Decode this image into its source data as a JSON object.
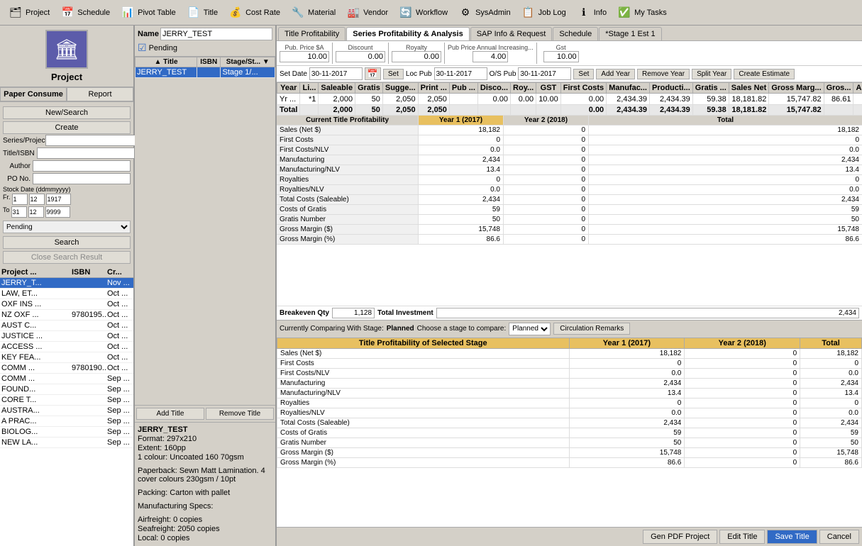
{
  "toolbar": {
    "items": [
      {
        "label": "Project",
        "icon": "🗂"
      },
      {
        "label": "Schedule",
        "icon": "📅"
      },
      {
        "label": "Pivot Table",
        "icon": "📊"
      },
      {
        "label": "Title",
        "icon": "📄"
      },
      {
        "label": "Cost Rate",
        "icon": "💰"
      },
      {
        "label": "Material",
        "icon": "🔧"
      },
      {
        "label": "Vendor",
        "icon": "🏭"
      },
      {
        "label": "Workflow",
        "icon": "🔄"
      },
      {
        "label": "SysAdmin",
        "icon": "⚙"
      },
      {
        "label": "Job Log",
        "icon": "📋"
      },
      {
        "label": "Info",
        "icon": "ℹ"
      },
      {
        "label": "My Tasks",
        "icon": "✅"
      }
    ]
  },
  "sidebar": {
    "project_label": "Project",
    "tabs": [
      {
        "label": "Paper Consume",
        "active": true
      },
      {
        "label": "Report"
      }
    ],
    "search_fields": [
      {
        "label": "Series/Project",
        "value": ""
      },
      {
        "label": "Title/ISBN",
        "value": ""
      },
      {
        "label": "Author",
        "value": ""
      },
      {
        "label": "PO No.",
        "value": ""
      }
    ],
    "stock_date_label": "Stock Date (ddmmyyyy)",
    "stock_from_dd": "1",
    "stock_from_mm": "12",
    "stock_from_yyyy": "1917",
    "stock_to_dd": "31",
    "stock_to_mm": "12",
    "stock_to_yyyy": "9999",
    "pending_options": [
      "Pending"
    ],
    "buttons": {
      "new_search": "New/Search",
      "create": "Create",
      "search": "Search",
      "close_search": "Close Search Result"
    }
  },
  "project_list": {
    "headers": [
      "Project ...",
      "ISBN",
      "Cr..."
    ],
    "rows": [
      {
        "col1": "JERRY_T...",
        "col2": "",
        "col3": "Nov ...",
        "selected": true
      },
      {
        "col1": "LAW, ET...",
        "col2": "",
        "col3": "Oct ..."
      },
      {
        "col1": "OXF INS ...",
        "col2": "",
        "col3": "Oct ..."
      },
      {
        "col1": "NZ OXF ...",
        "col2": "9780195...",
        "col3": "Oct ..."
      },
      {
        "col1": "AUST C...",
        "col2": "",
        "col3": "Oct ..."
      },
      {
        "col1": "JUSTICE ...",
        "col2": "",
        "col3": "Oct ..."
      },
      {
        "col1": "ACCESS ...",
        "col2": "",
        "col3": "Oct ..."
      },
      {
        "col1": "KEY FEA...",
        "col2": "",
        "col3": "Oct ..."
      },
      {
        "col1": "COMM ...",
        "col2": "9780190...",
        "col3": "Oct ..."
      },
      {
        "col1": "COMM ...",
        "col2": "",
        "col3": "Sep ..."
      },
      {
        "col1": "FOUND...",
        "col2": "",
        "col3": "Sep ..."
      },
      {
        "col1": "CORE T...",
        "col2": "",
        "col3": "Sep ..."
      },
      {
        "col1": "AUSTRA...",
        "col2": "",
        "col3": "Sep ..."
      },
      {
        "col1": "A PRAC...",
        "col2": "",
        "col3": "Sep ..."
      },
      {
        "col1": "BIOLOG...",
        "col2": "",
        "col3": "Sep ..."
      },
      {
        "col1": "NEW LA...",
        "col2": "",
        "col3": "Sep ..."
      }
    ]
  },
  "middle": {
    "name_label": "Name",
    "name_value": "JERRY_TEST",
    "pending_checked": true,
    "pending_label": "Pending",
    "titles_headers": [
      "Title",
      "ISBN",
      "Stage/St..."
    ],
    "titles": [
      {
        "title": "JERRY_TEST",
        "isbn": "",
        "stage": "Stage 1/...",
        "selected": true
      }
    ],
    "buttons": {
      "add": "Add Title",
      "remove": "Remove Title"
    },
    "title_info": {
      "name": "JERRY_TEST",
      "format": "Format: 297x210",
      "extent": "Extent: 160pp",
      "colour": "1 colour: Uncoated 160 70gsm",
      "binding": "Paperback: Sewn Matt Lamination. 4 cover colours 230gsm / 10pt",
      "packing": "Packing: Carton with pallet",
      "manuf_specs": "Manufacturing Specs:",
      "airfreight": "Airfreight: 0 copies",
      "seafreight": "Seafreight: 2050 copies",
      "local": "Local: 0 copies"
    }
  },
  "right": {
    "tabs": [
      {
        "label": "Title Profitability"
      },
      {
        "label": "Series Profitability & Analysis",
        "active": true
      },
      {
        "label": "SAP Info & Request"
      },
      {
        "label": "Schedule"
      },
      {
        "label": "*Stage 1 Est 1"
      }
    ],
    "pub_price_label": "Pub. Price $A",
    "pub_price_value": "10.00",
    "discount_label": "Discount",
    "discount_value": "0.00",
    "royalty_label": "Royalty",
    "royalty_value": "0.00",
    "pub_price_annual_label": "Pub Price Annual Increasing...",
    "pub_price_annual_value": "4.00",
    "gst_label": "Gst",
    "gst_value": "10.00",
    "date_row": {
      "set_date_label": "Set Date",
      "set_date_value": "30-11-2017",
      "set_btn": "Set",
      "loc_pub_label": "Loc Pub",
      "loc_pub_value": "30-11-2017",
      "os_pub_label": "O/S Pub",
      "os_pub_value": "30-11-2017",
      "set_btn2": "Set",
      "add_year_btn": "Add Year",
      "remove_year_btn": "Remove Year",
      "split_year_btn": "Split Year",
      "create_estimate_btn": "Create Estimate"
    },
    "data_table": {
      "headers": [
        "Year",
        "Li...",
        "Saleable",
        "Gratis",
        "Sugge...",
        "Print ...",
        "Pub ...",
        "Disco...",
        "Roy...",
        "GST",
        "First Costs",
        "Manufac...",
        "Producti...",
        "Gratis ...",
        "Sales Net",
        "Gross Marg...",
        "Gros...",
        "Au..."
      ],
      "rows": [
        {
          "yr": "Yr ...",
          "li": "*1",
          "saleable": "2,000",
          "gratis": "50",
          "sugge": "2,050",
          "print": "2,050",
          "pub": "",
          "disco": "0.00",
          "roy": "0.00",
          "gst": "10.00",
          "first_costs": "0.00",
          "manuf": "2,434.39",
          "prod": "2,434.39",
          "gratis_c": "59.38",
          "sales_net": "18,181.82",
          "gross_marg": "15,747.82",
          "gros_pct": "86.61",
          "au": "✓"
        },
        {
          "yr": "Total",
          "li": "",
          "saleable": "2,000",
          "gratis": "50",
          "sugge": "2,050",
          "print": "2,050",
          "pub": "",
          "disco": "",
          "roy": "",
          "gst": "",
          "first_costs": "0.00",
          "manuf": "2,434.39",
          "prod": "2,434.39",
          "gratis_c": "59.38",
          "sales_net": "18,181.82",
          "gross_marg": "15,747.82",
          "gros_pct": "",
          "au": "",
          "is_total": true
        }
      ]
    },
    "profitability": {
      "current_label": "Current Title Profitability",
      "year1_label": "Year 1 (2017)",
      "year2_label": "Year 2 (2018)",
      "total_label": "Total",
      "rows": [
        {
          "label": "Sales (Net $)",
          "y1": "18,182",
          "y2": "0",
          "total": "18,182"
        },
        {
          "label": "First Costs",
          "y1": "0",
          "y2": "0",
          "total": "0"
        },
        {
          "label": "First Costs/NLV",
          "y1": "0.0",
          "y2": "0",
          "total": "0.0"
        },
        {
          "label": "Manufacturing",
          "y1": "2,434",
          "y2": "0",
          "total": "2,434"
        },
        {
          "label": "Manufacturing/NLV",
          "y1": "13.4",
          "y2": "0",
          "total": "13.4"
        },
        {
          "label": "Royalties",
          "y1": "0",
          "y2": "0",
          "total": "0"
        },
        {
          "label": "Royalties/NLV",
          "y1": "0.0",
          "y2": "0",
          "total": "0.0"
        },
        {
          "label": "Total Costs (Saleable)",
          "y1": "2,434",
          "y2": "0",
          "total": "2,434"
        },
        {
          "label": "Costs of Gratis",
          "y1": "59",
          "y2": "0",
          "total": "59"
        },
        {
          "label": "Gratis Number",
          "y1": "50",
          "y2": "0",
          "total": "50"
        },
        {
          "label": "Gross Margin ($)",
          "y1": "15,748",
          "y2": "0",
          "total": "15,748"
        },
        {
          "label": "Gross Margin (%)",
          "y1": "86.6",
          "y2": "0",
          "total": "86.6"
        }
      ]
    },
    "breakeven": {
      "qty_label": "Breakeven Qty",
      "qty_value": "1,128",
      "inv_label": "Total Investment",
      "inv_value": "2,434"
    },
    "comparing": {
      "label": "Currently Comparing With Stage:",
      "value": "Planned",
      "choose_label": "Choose a stage to compare:",
      "choose_value": "Planned",
      "btn": "Circulation Remarks"
    },
    "comp_table": {
      "header": "Title Profitability of Selected Stage",
      "year1": "Year 1 (2017)",
      "year2": "Year 2 (2018)",
      "total": "Total",
      "rows": [
        {
          "label": "Sales (Net $)",
          "y1": "18,182",
          "y2": "0",
          "total": "18,182"
        },
        {
          "label": "First Costs",
          "y1": "0",
          "y2": "0",
          "total": "0"
        },
        {
          "label": "First Costs/NLV",
          "y1": "0.0",
          "y2": "0",
          "total": "0.0"
        },
        {
          "label": "Manufacturing",
          "y1": "2,434",
          "y2": "0",
          "total": "2,434"
        },
        {
          "label": "Manufacturing/NLV",
          "y1": "13.4",
          "y2": "0",
          "total": "13.4"
        },
        {
          "label": "Royalties",
          "y1": "0",
          "y2": "0",
          "total": "0"
        },
        {
          "label": "Royalties/NLV",
          "y1": "0.0",
          "y2": "0",
          "total": "0.0"
        },
        {
          "label": "Total Costs (Saleable)",
          "y1": "2,434",
          "y2": "0",
          "total": "2,434"
        },
        {
          "label": "Costs of Gratis",
          "y1": "59",
          "y2": "0",
          "total": "59"
        },
        {
          "label": "Gratis Number",
          "y1": "50",
          "y2": "0",
          "total": "50"
        },
        {
          "label": "Gross Margin ($)",
          "y1": "15,748",
          "y2": "0",
          "total": "15,748"
        },
        {
          "label": "Gross Margin (%)",
          "y1": "86.6",
          "y2": "0",
          "total": "86.6"
        }
      ]
    },
    "bottom_buttons": {
      "gen_pdf": "Gen PDF Project",
      "edit_title": "Edit Title",
      "save_title": "Save Title",
      "cancel": "Cancel"
    }
  }
}
